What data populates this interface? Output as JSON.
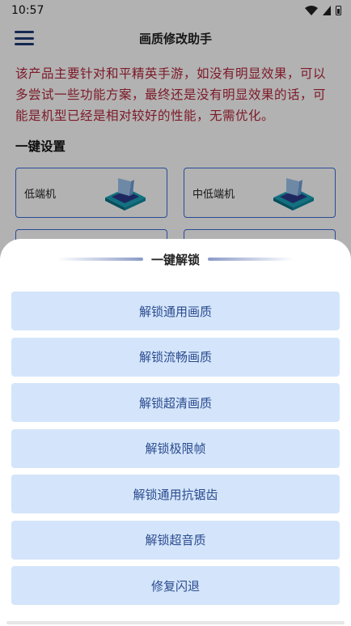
{
  "status_bar": {
    "time": "10:57"
  },
  "app": {
    "title": "画质修改助手",
    "notice": "该产品主要针对和平精英手游，如没有明显效果，可以多尝试一些功能方案，最终还是没有明显效果的话，可能是机型已经是相对较好的性能，无需优化。",
    "section_title": "一键设置",
    "cards": [
      {
        "label": "低端机",
        "icon": "device-chip-icon"
      },
      {
        "label": "中低端机",
        "icon": "device-chip-icon"
      },
      {
        "label": "",
        "icon": "device-chip-icon"
      },
      {
        "label": "",
        "icon": "device-chip-icon"
      }
    ]
  },
  "sheet": {
    "title": "一键解锁",
    "buttons": [
      {
        "label": "解锁通用画质"
      },
      {
        "label": "解锁流畅画质"
      },
      {
        "label": "解锁超清画质"
      },
      {
        "label": "解锁极限帧"
      },
      {
        "label": "解锁通用抗锯齿"
      },
      {
        "label": "解锁超音质"
      },
      {
        "label": "修复闪退"
      }
    ]
  },
  "colors": {
    "accent": "#3d6bd8",
    "notice_text": "#b3263a",
    "button_bg": "#d4e5fb",
    "button_text": "#2a4a8e"
  }
}
